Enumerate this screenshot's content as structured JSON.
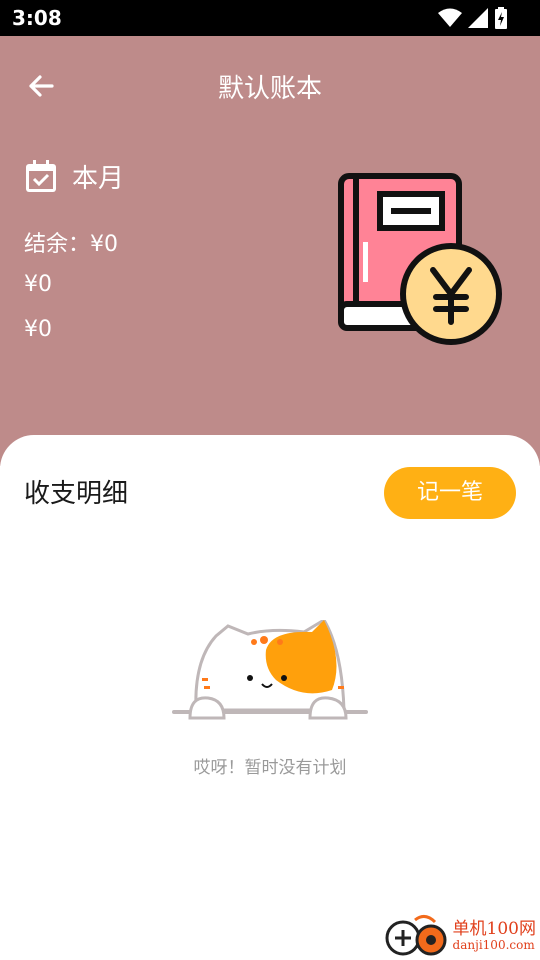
{
  "status_bar": {
    "time": "3:08",
    "icons": [
      "wifi-icon",
      "signal-icon",
      "battery-charging-icon"
    ]
  },
  "header": {
    "title": "默认账本",
    "back_icon": "arrow-left-icon",
    "period_icon": "calendar-check-icon",
    "period_label": "本月",
    "balance": "结余：¥0",
    "income": "¥0",
    "expense": "¥0",
    "illustration": "ledger-book-yuan-icon"
  },
  "details": {
    "section_title": "收支明细",
    "add_button": "记一笔",
    "empty_illustration": "peeking-cat-icon",
    "empty_text": "哎呀！暂时没有计划"
  },
  "watermark": {
    "brand": "单机100网",
    "url": "danji100.com",
    "logo": "danji100-logo-icon"
  },
  "colors": {
    "header_bg": "#BE8B8A",
    "accent_button": "#FFB014",
    "book_pink": "#FF8396",
    "coin_yellow": "#FFD98E",
    "cat_orange": "#FFA00C",
    "status_bg": "#000000"
  }
}
